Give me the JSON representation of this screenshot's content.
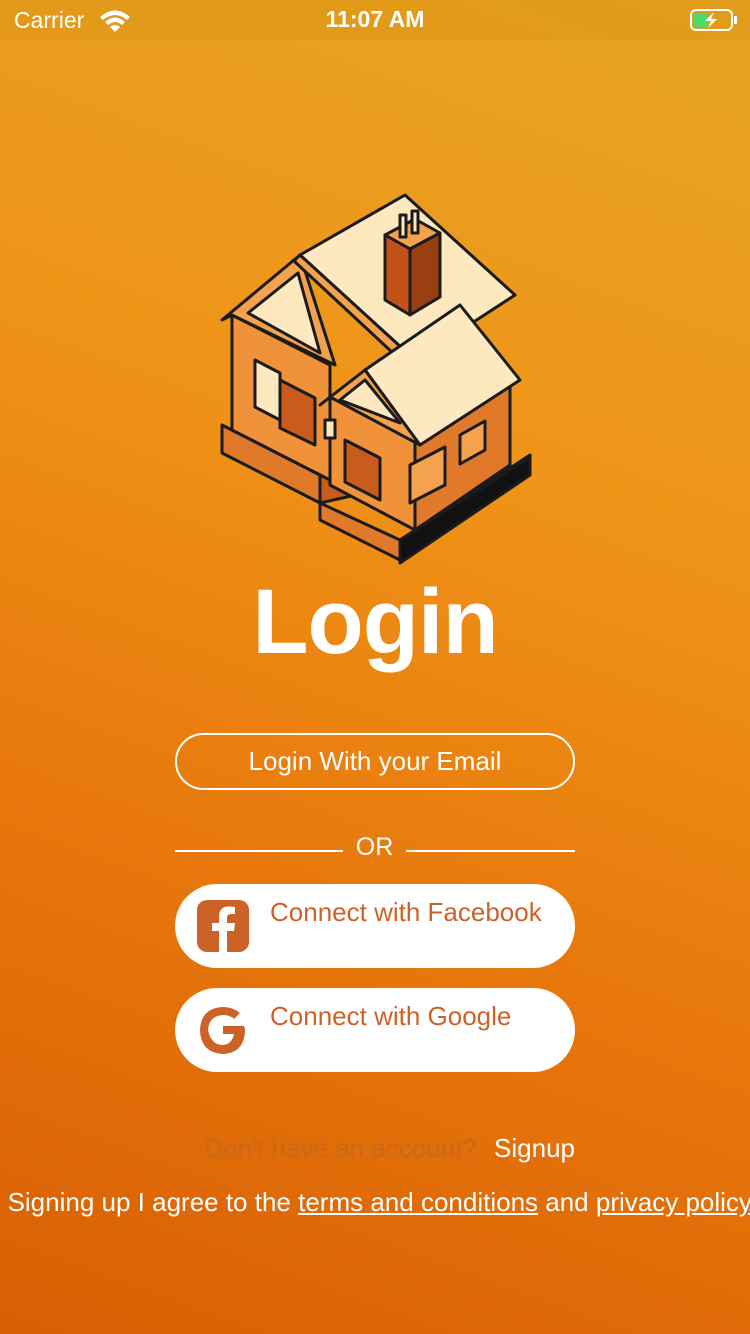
{
  "status_bar": {
    "carrier": "Carrier",
    "time": "11:07 AM",
    "wifi_icon": "wifi-icon",
    "battery_icon": "battery-charging-icon"
  },
  "illustration": {
    "icon": "house-illustration"
  },
  "page": {
    "title": "Login"
  },
  "email_button": {
    "label": "Login With your Email"
  },
  "divider": {
    "label": "OR"
  },
  "facebook_button": {
    "label": "Connect with Facebook",
    "icon": "facebook-icon"
  },
  "google_button": {
    "label": "Connect with Google",
    "icon": "google-icon"
  },
  "signup": {
    "prompt": "Don't have an account?",
    "link": "Signup"
  },
  "terms": {
    "prefix": "By Signing up I agree to the ",
    "terms_link": "terms and conditions",
    "middle": " and ",
    "privacy_link": "privacy policy"
  },
  "colors": {
    "accent": "#cd6228",
    "gradient_top": "#e6a525",
    "gradient_bottom": "#d85f04",
    "text_light": "#ffffff"
  }
}
